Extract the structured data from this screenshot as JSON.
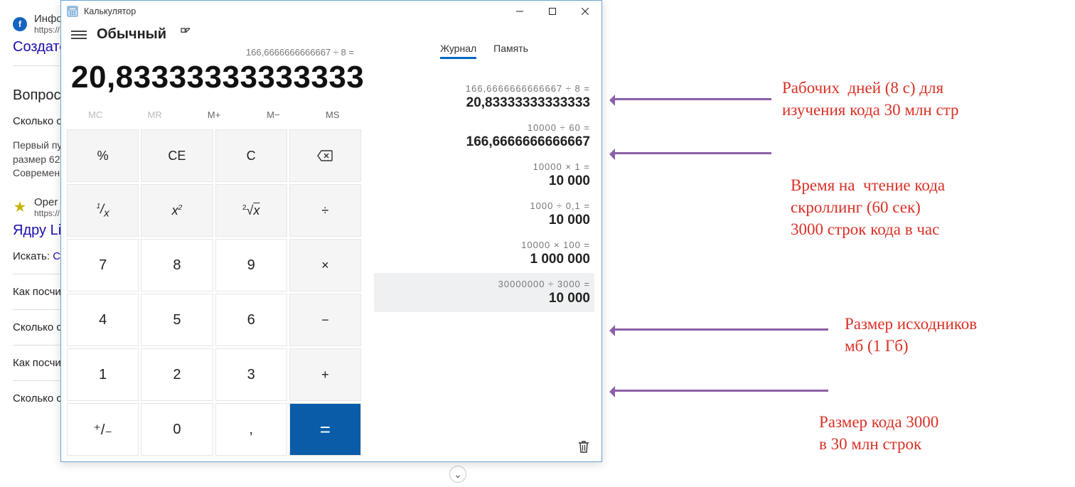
{
  "bg": {
    "site1_label": "Инфо",
    "site1_url": "https://",
    "title1": "Создате",
    "heading_questions": "Вопрос",
    "q1": "Сколько с",
    "text_block": "Первый пу\nразмер 62\nСовремен",
    "site2_label": "Oper",
    "site2_url": "https://",
    "title2": "Ядру Li",
    "search_label": "Искать:",
    "search_link": "С",
    "q2": "Как посчи",
    "q3": "Сколько с",
    "q4": "Как посчи",
    "q5": "Сколько строк кода в Linux?"
  },
  "calc": {
    "window_title": "Калькулятор",
    "mode": "Обычный",
    "tabs": {
      "history": "Журнал",
      "memory": "Память"
    },
    "expression": "166,6666666666667 ÷ 8 =",
    "display": "20,83333333333333",
    "memory_buttons": [
      "MC",
      "MR",
      "M+",
      "M−",
      "MS"
    ],
    "keys": {
      "percent": "%",
      "ce": "CE",
      "c": "C",
      "back": "⌫",
      "inv": "¹/ₓ",
      "sq": "x²",
      "sqrt": "²√x",
      "div": "÷",
      "k7": "7",
      "k8": "8",
      "k9": "9",
      "mul": "×",
      "k4": "4",
      "k5": "5",
      "k6": "6",
      "sub": "−",
      "k1": "1",
      "k2": "2",
      "k3": "3",
      "add": "+",
      "sign": "⁺/₋",
      "k0": "0",
      "dot": ",",
      "eq": "="
    },
    "history": [
      {
        "expr": "166,6666666666667  ÷  8 =",
        "result": "20,83333333333333"
      },
      {
        "expr": "10000  ÷  60 =",
        "result": "166,6666666666667"
      },
      {
        "expr": "10000  ×  1 =",
        "result": "10 000"
      },
      {
        "expr": "1000  ÷  0,1 =",
        "result": "10 000"
      },
      {
        "expr": "10000  ×  100 =",
        "result": "1 000 000"
      },
      {
        "expr": "30000000  ÷  3000 =",
        "result": "10 000"
      }
    ]
  },
  "annotations": {
    "a1": "Рабочих  дней (8 с) для\nизучения кода 30 млн стр",
    "a2": "Время на  чтение кода\nскроллинг (60 сек)\n3000 строк кода в час",
    "a3": "Размер исходников\nмб (1 Гб)",
    "a4": "Размер кода 3000\nв 30 млн строк"
  }
}
